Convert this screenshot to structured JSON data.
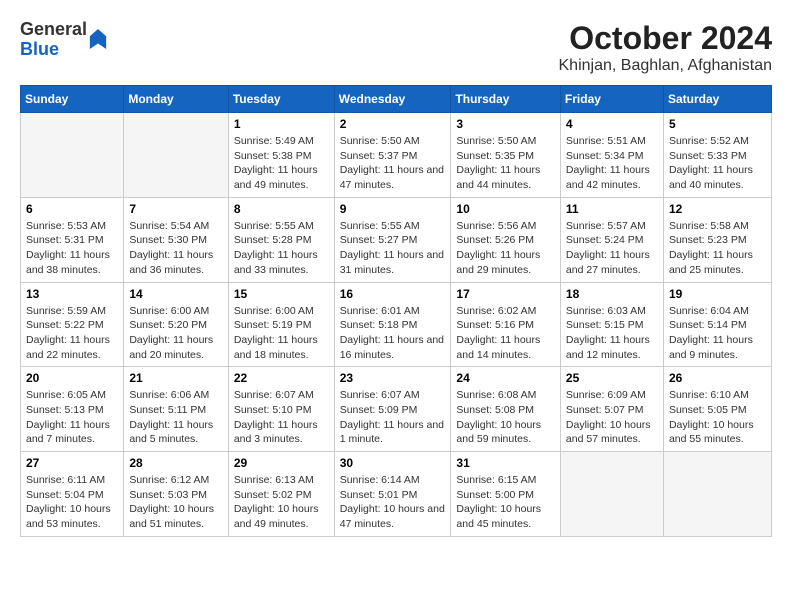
{
  "header": {
    "logo_general": "General",
    "logo_blue": "Blue",
    "title": "October 2024",
    "subtitle": "Khinjan, Baghlan, Afghanistan"
  },
  "days_of_week": [
    "Sunday",
    "Monday",
    "Tuesday",
    "Wednesday",
    "Thursday",
    "Friday",
    "Saturday"
  ],
  "weeks": [
    [
      {
        "day": "",
        "sunrise": "",
        "sunset": "",
        "daylight": ""
      },
      {
        "day": "",
        "sunrise": "",
        "sunset": "",
        "daylight": ""
      },
      {
        "day": "1",
        "sunrise": "Sunrise: 5:49 AM",
        "sunset": "Sunset: 5:38 PM",
        "daylight": "Daylight: 11 hours and 49 minutes."
      },
      {
        "day": "2",
        "sunrise": "Sunrise: 5:50 AM",
        "sunset": "Sunset: 5:37 PM",
        "daylight": "Daylight: 11 hours and 47 minutes."
      },
      {
        "day": "3",
        "sunrise": "Sunrise: 5:50 AM",
        "sunset": "Sunset: 5:35 PM",
        "daylight": "Daylight: 11 hours and 44 minutes."
      },
      {
        "day": "4",
        "sunrise": "Sunrise: 5:51 AM",
        "sunset": "Sunset: 5:34 PM",
        "daylight": "Daylight: 11 hours and 42 minutes."
      },
      {
        "day": "5",
        "sunrise": "Sunrise: 5:52 AM",
        "sunset": "Sunset: 5:33 PM",
        "daylight": "Daylight: 11 hours and 40 minutes."
      }
    ],
    [
      {
        "day": "6",
        "sunrise": "Sunrise: 5:53 AM",
        "sunset": "Sunset: 5:31 PM",
        "daylight": "Daylight: 11 hours and 38 minutes."
      },
      {
        "day": "7",
        "sunrise": "Sunrise: 5:54 AM",
        "sunset": "Sunset: 5:30 PM",
        "daylight": "Daylight: 11 hours and 36 minutes."
      },
      {
        "day": "8",
        "sunrise": "Sunrise: 5:55 AM",
        "sunset": "Sunset: 5:28 PM",
        "daylight": "Daylight: 11 hours and 33 minutes."
      },
      {
        "day": "9",
        "sunrise": "Sunrise: 5:55 AM",
        "sunset": "Sunset: 5:27 PM",
        "daylight": "Daylight: 11 hours and 31 minutes."
      },
      {
        "day": "10",
        "sunrise": "Sunrise: 5:56 AM",
        "sunset": "Sunset: 5:26 PM",
        "daylight": "Daylight: 11 hours and 29 minutes."
      },
      {
        "day": "11",
        "sunrise": "Sunrise: 5:57 AM",
        "sunset": "Sunset: 5:24 PM",
        "daylight": "Daylight: 11 hours and 27 minutes."
      },
      {
        "day": "12",
        "sunrise": "Sunrise: 5:58 AM",
        "sunset": "Sunset: 5:23 PM",
        "daylight": "Daylight: 11 hours and 25 minutes."
      }
    ],
    [
      {
        "day": "13",
        "sunrise": "Sunrise: 5:59 AM",
        "sunset": "Sunset: 5:22 PM",
        "daylight": "Daylight: 11 hours and 22 minutes."
      },
      {
        "day": "14",
        "sunrise": "Sunrise: 6:00 AM",
        "sunset": "Sunset: 5:20 PM",
        "daylight": "Daylight: 11 hours and 20 minutes."
      },
      {
        "day": "15",
        "sunrise": "Sunrise: 6:00 AM",
        "sunset": "Sunset: 5:19 PM",
        "daylight": "Daylight: 11 hours and 18 minutes."
      },
      {
        "day": "16",
        "sunrise": "Sunrise: 6:01 AM",
        "sunset": "Sunset: 5:18 PM",
        "daylight": "Daylight: 11 hours and 16 minutes."
      },
      {
        "day": "17",
        "sunrise": "Sunrise: 6:02 AM",
        "sunset": "Sunset: 5:16 PM",
        "daylight": "Daylight: 11 hours and 14 minutes."
      },
      {
        "day": "18",
        "sunrise": "Sunrise: 6:03 AM",
        "sunset": "Sunset: 5:15 PM",
        "daylight": "Daylight: 11 hours and 12 minutes."
      },
      {
        "day": "19",
        "sunrise": "Sunrise: 6:04 AM",
        "sunset": "Sunset: 5:14 PM",
        "daylight": "Daylight: 11 hours and 9 minutes."
      }
    ],
    [
      {
        "day": "20",
        "sunrise": "Sunrise: 6:05 AM",
        "sunset": "Sunset: 5:13 PM",
        "daylight": "Daylight: 11 hours and 7 minutes."
      },
      {
        "day": "21",
        "sunrise": "Sunrise: 6:06 AM",
        "sunset": "Sunset: 5:11 PM",
        "daylight": "Daylight: 11 hours and 5 minutes."
      },
      {
        "day": "22",
        "sunrise": "Sunrise: 6:07 AM",
        "sunset": "Sunset: 5:10 PM",
        "daylight": "Daylight: 11 hours and 3 minutes."
      },
      {
        "day": "23",
        "sunrise": "Sunrise: 6:07 AM",
        "sunset": "Sunset: 5:09 PM",
        "daylight": "Daylight: 11 hours and 1 minute."
      },
      {
        "day": "24",
        "sunrise": "Sunrise: 6:08 AM",
        "sunset": "Sunset: 5:08 PM",
        "daylight": "Daylight: 10 hours and 59 minutes."
      },
      {
        "day": "25",
        "sunrise": "Sunrise: 6:09 AM",
        "sunset": "Sunset: 5:07 PM",
        "daylight": "Daylight: 10 hours and 57 minutes."
      },
      {
        "day": "26",
        "sunrise": "Sunrise: 6:10 AM",
        "sunset": "Sunset: 5:05 PM",
        "daylight": "Daylight: 10 hours and 55 minutes."
      }
    ],
    [
      {
        "day": "27",
        "sunrise": "Sunrise: 6:11 AM",
        "sunset": "Sunset: 5:04 PM",
        "daylight": "Daylight: 10 hours and 53 minutes."
      },
      {
        "day": "28",
        "sunrise": "Sunrise: 6:12 AM",
        "sunset": "Sunset: 5:03 PM",
        "daylight": "Daylight: 10 hours and 51 minutes."
      },
      {
        "day": "29",
        "sunrise": "Sunrise: 6:13 AM",
        "sunset": "Sunset: 5:02 PM",
        "daylight": "Daylight: 10 hours and 49 minutes."
      },
      {
        "day": "30",
        "sunrise": "Sunrise: 6:14 AM",
        "sunset": "Sunset: 5:01 PM",
        "daylight": "Daylight: 10 hours and 47 minutes."
      },
      {
        "day": "31",
        "sunrise": "Sunrise: 6:15 AM",
        "sunset": "Sunset: 5:00 PM",
        "daylight": "Daylight: 10 hours and 45 minutes."
      },
      {
        "day": "",
        "sunrise": "",
        "sunset": "",
        "daylight": ""
      },
      {
        "day": "",
        "sunrise": "",
        "sunset": "",
        "daylight": ""
      }
    ]
  ]
}
